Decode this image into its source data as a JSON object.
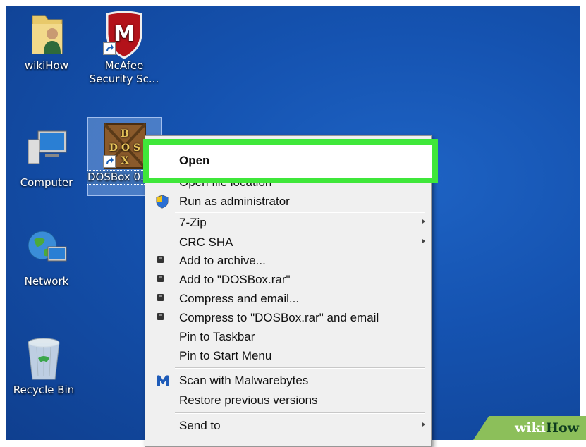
{
  "desktop": {
    "icons": [
      {
        "label": "wikiHow"
      },
      {
        "label": "McAfee\nSecurity Sc..."
      },
      {
        "label": "Computer"
      },
      {
        "label": "DOSBox 0..."
      },
      {
        "label": "Network"
      },
      {
        "label": "Recycle Bin"
      }
    ]
  },
  "context_menu": {
    "items": [
      {
        "label": "Open"
      },
      {
        "label": "Open file location"
      },
      {
        "label": "Run as administrator",
        "icon": "uac-shield-icon"
      },
      {
        "label": "7-Zip",
        "submenu": true
      },
      {
        "label": "CRC SHA",
        "submenu": true
      },
      {
        "label": "Add to archive...",
        "icon": "winrar-icon"
      },
      {
        "label": "Add to \"DOSBox.rar\"",
        "icon": "winrar-icon"
      },
      {
        "label": "Compress and email...",
        "icon": "winrar-icon"
      },
      {
        "label": "Compress to \"DOSBox.rar\" and email",
        "icon": "winrar-icon"
      },
      {
        "label": "Pin to Taskbar"
      },
      {
        "label": "Pin to Start Menu"
      },
      {
        "label": "Scan with Malwarebytes",
        "icon": "malwarebytes-icon"
      },
      {
        "label": "Restore previous versions"
      },
      {
        "label": "Send to",
        "submenu": true
      }
    ]
  },
  "highlight_color": "#3fe73a",
  "watermark": {
    "part1": "wiki",
    "part2": "How"
  }
}
